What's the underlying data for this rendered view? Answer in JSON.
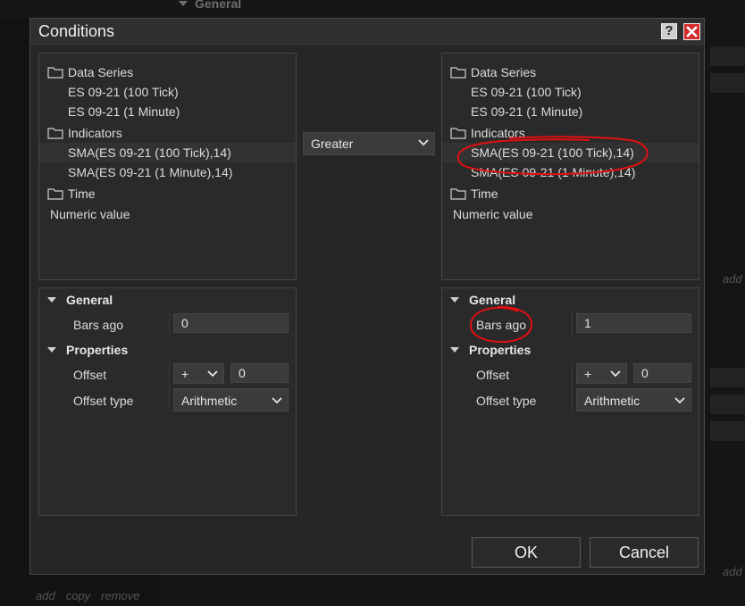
{
  "dialog": {
    "title": "Conditions",
    "help_label": "?",
    "ok_label": "OK",
    "cancel_label": "Cancel",
    "close_icon": "close-icon"
  },
  "background": {
    "section_label": "General",
    "add_label": "add",
    "footer": [
      "add",
      "copy",
      "remove"
    ]
  },
  "left_tree": {
    "data_series_label": "Data Series",
    "series": [
      "ES 09-21 (100 Tick)",
      "ES 09-21 (1 Minute)"
    ],
    "indicators_label": "Indicators",
    "indicators": [
      "SMA(ES 09-21 (100 Tick),14)",
      "SMA(ES 09-21 (1 Minute),14)"
    ],
    "time_label": "Time",
    "numeric_label": "Numeric value",
    "selected_index": 0
  },
  "operator": {
    "value": "Greater"
  },
  "right_tree": {
    "data_series_label": "Data Series",
    "series": [
      "ES 09-21 (100 Tick)",
      "ES 09-21 (1 Minute)"
    ],
    "indicators_label": "Indicators",
    "indicators": [
      "SMA(ES 09-21 (100 Tick),14)",
      "SMA(ES 09-21 (1 Minute),14)"
    ],
    "time_label": "Time",
    "numeric_label": "Numeric value",
    "selected_index": 0
  },
  "left_props": {
    "general_label": "General",
    "bars_ago_label": "Bars ago",
    "bars_ago_value": "0",
    "properties_label": "Properties",
    "offset_label": "Offset",
    "offset_sign": "+",
    "offset_value": "0",
    "offset_type_label": "Offset type",
    "offset_type_value": "Arithmetic"
  },
  "right_props": {
    "general_label": "General",
    "bars_ago_label": "Bars ago",
    "bars_ago_value": "1",
    "properties_label": "Properties",
    "offset_label": "Offset",
    "offset_sign": "+",
    "offset_value": "0",
    "offset_type_label": "Offset type",
    "offset_type_value": "Arithmetic"
  },
  "colors": {
    "annotation": "#e01010",
    "close_button": "#d42a2a"
  }
}
